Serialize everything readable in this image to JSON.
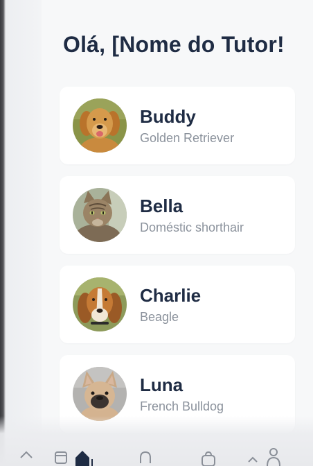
{
  "header": {
    "greeting": "Olá, [Nome do Tutor!"
  },
  "pets": [
    {
      "name": "Buddy",
      "breed": "Golden Retriever",
      "avatar_icon": "golden-retriever-photo"
    },
    {
      "name": "Bella",
      "breed": "Doméstic shorthair",
      "avatar_icon": "tabby-cat-photo"
    },
    {
      "name": "Charlie",
      "breed": "Beagle",
      "avatar_icon": "beagle-photo"
    },
    {
      "name": "Luna",
      "breed": "French Bulldog",
      "avatar_icon": "french-bulldog-photo"
    }
  ],
  "nav": {
    "icons": [
      "home-outline-icon",
      "calendar-icon",
      "home-icon",
      "bell-icon",
      "bag-icon",
      "share-icon",
      "profile-icon"
    ],
    "active": "home-icon"
  },
  "colors": {
    "title": "#1f2c44",
    "subtitle": "#8b929c",
    "card": "#ffffff",
    "background": "#f7f8f9",
    "nav_active": "#1f2c44",
    "nav_inactive": "#8a8f98"
  }
}
